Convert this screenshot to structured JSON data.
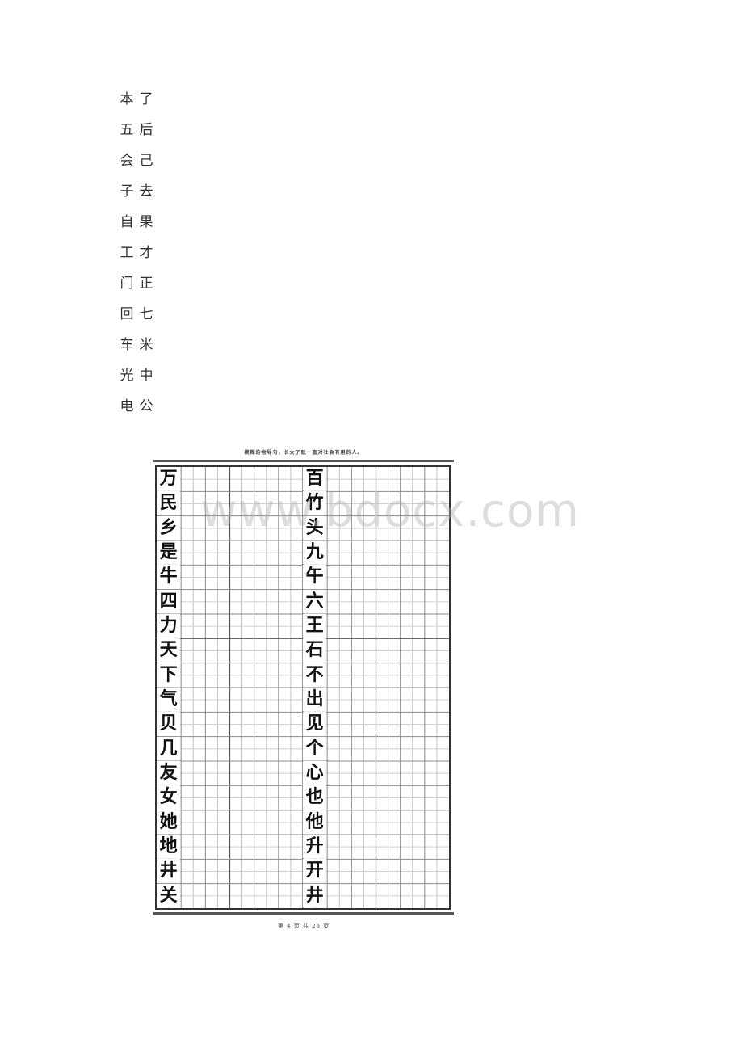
{
  "top_list": {
    "pairs": [
      [
        "本",
        "了"
      ],
      [
        "五",
        "后"
      ],
      [
        "会",
        "己"
      ],
      [
        "子",
        "去"
      ],
      [
        "自",
        "果"
      ],
      [
        "工",
        "才"
      ],
      [
        "门",
        "正"
      ],
      [
        "回",
        "七"
      ],
      [
        "车",
        "米"
      ],
      [
        "光",
        "中"
      ],
      [
        "电",
        "公"
      ]
    ]
  },
  "worksheet": {
    "header_text": "模糊的物导句，长大了就一直对社会有用的人。",
    "rows": 18,
    "columns": 12,
    "left_column_chars": [
      "万",
      "民",
      "乡",
      "是",
      "牛",
      "四",
      "力",
      "天",
      "下",
      "气",
      "贝",
      "几",
      "友",
      "女",
      "她",
      "地",
      "井",
      "关"
    ],
    "right_column_chars": [
      "百",
      "竹",
      "头",
      "九",
      "午",
      "六",
      "王",
      "石",
      "不",
      "出",
      "见",
      "个",
      "心",
      "也",
      "他",
      "升",
      "开",
      "井"
    ],
    "footer": "第 4 页 共 26 页"
  },
  "watermark": "www.bdocx.com"
}
